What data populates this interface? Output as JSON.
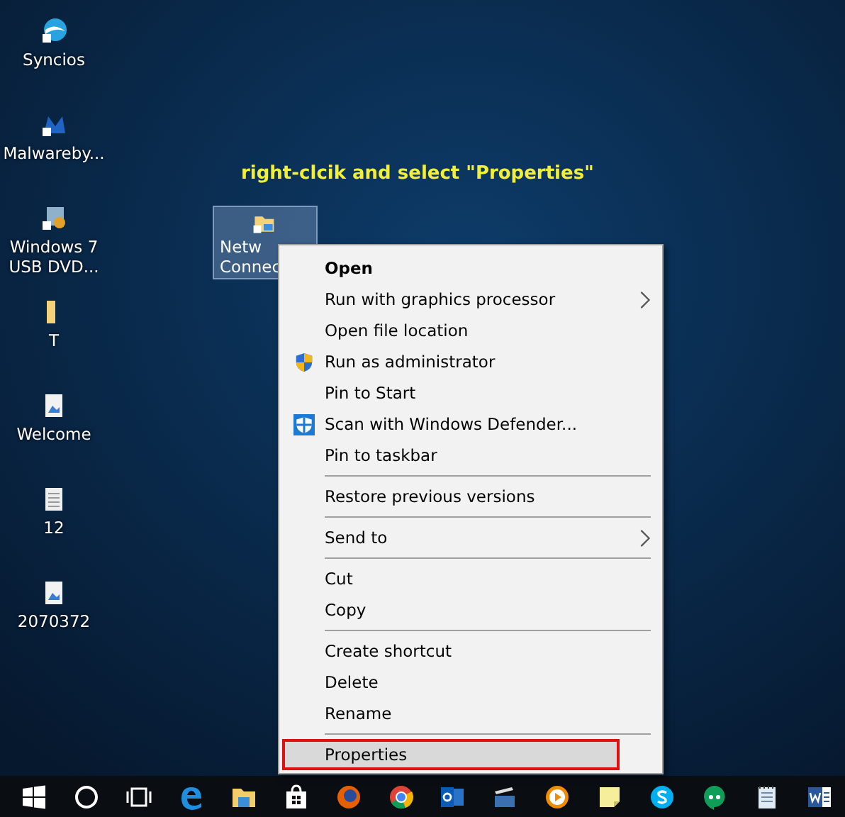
{
  "desktop_icons": [
    {
      "label": "Syncios",
      "kind": "app"
    },
    {
      "label": "Malwareby...",
      "kind": "malware"
    },
    {
      "label": "Windows 7\nUSB DVD...",
      "kind": "installer"
    },
    {
      "label": "T",
      "kind": "folder"
    },
    {
      "label": "Welcome",
      "kind": "image"
    },
    {
      "label": "12",
      "kind": "document"
    },
    {
      "label": "2070372",
      "kind": "image"
    }
  ],
  "selected_icon": {
    "label_line_1": "Netw",
    "label_line_2": "Connec",
    "selected": true
  },
  "annotation": "right-clcik and select \"Properties\"",
  "context_menu": [
    {
      "kind": "item",
      "label": "Open",
      "bold": true,
      "submenu": false,
      "selected": false,
      "annotated": false
    },
    {
      "kind": "item",
      "label": "Run with graphics processor",
      "bold": false,
      "submenu": true,
      "selected": false,
      "annotated": false
    },
    {
      "kind": "item",
      "label": "Open file location",
      "bold": false,
      "submenu": false,
      "selected": false,
      "annotated": false
    },
    {
      "kind": "shield_item",
      "label": "Run as administrator",
      "bold": false,
      "submenu": false,
      "selected": false,
      "annotated": false
    },
    {
      "kind": "item",
      "label": "Pin to Start",
      "bold": false,
      "submenu": false,
      "selected": false,
      "annotated": false
    },
    {
      "kind": "defender_item",
      "label": "Scan with Windows Defender...",
      "bold": false,
      "submenu": false,
      "selected": false,
      "annotated": false
    },
    {
      "kind": "item",
      "label": "Pin to taskbar",
      "bold": false,
      "submenu": false,
      "selected": false,
      "annotated": false
    },
    {
      "kind": "separator"
    },
    {
      "kind": "item",
      "label": "Restore previous versions",
      "bold": false,
      "submenu": false,
      "selected": false,
      "annotated": false
    },
    {
      "kind": "separator"
    },
    {
      "kind": "item",
      "label": "Send to",
      "bold": false,
      "submenu": true,
      "selected": false,
      "annotated": false
    },
    {
      "kind": "separator"
    },
    {
      "kind": "item",
      "label": "Cut",
      "bold": false,
      "submenu": false,
      "selected": false,
      "annotated": false
    },
    {
      "kind": "item",
      "label": "Copy",
      "bold": false,
      "submenu": false,
      "selected": false,
      "annotated": false
    },
    {
      "kind": "separator"
    },
    {
      "kind": "item",
      "label": "Create shortcut",
      "bold": false,
      "submenu": false,
      "selected": false,
      "annotated": false
    },
    {
      "kind": "item",
      "label": "Delete",
      "bold": false,
      "submenu": false,
      "selected": false,
      "annotated": false
    },
    {
      "kind": "item",
      "label": "Rename",
      "bold": false,
      "submenu": false,
      "selected": false,
      "annotated": false
    },
    {
      "kind": "separator"
    },
    {
      "kind": "item",
      "label": "Properties",
      "bold": false,
      "submenu": false,
      "selected": true,
      "annotated": true
    }
  ],
  "taskbar": [
    {
      "kind": "start"
    },
    {
      "kind": "search"
    },
    {
      "kind": "taskview"
    },
    {
      "kind": "edge"
    },
    {
      "kind": "explorer"
    },
    {
      "kind": "store"
    },
    {
      "kind": "firefox"
    },
    {
      "kind": "chrome"
    },
    {
      "kind": "outlook"
    },
    {
      "kind": "movie"
    },
    {
      "kind": "player"
    },
    {
      "kind": "notes"
    },
    {
      "kind": "skype"
    },
    {
      "kind": "chat"
    },
    {
      "kind": "notepad"
    },
    {
      "kind": "word"
    }
  ]
}
